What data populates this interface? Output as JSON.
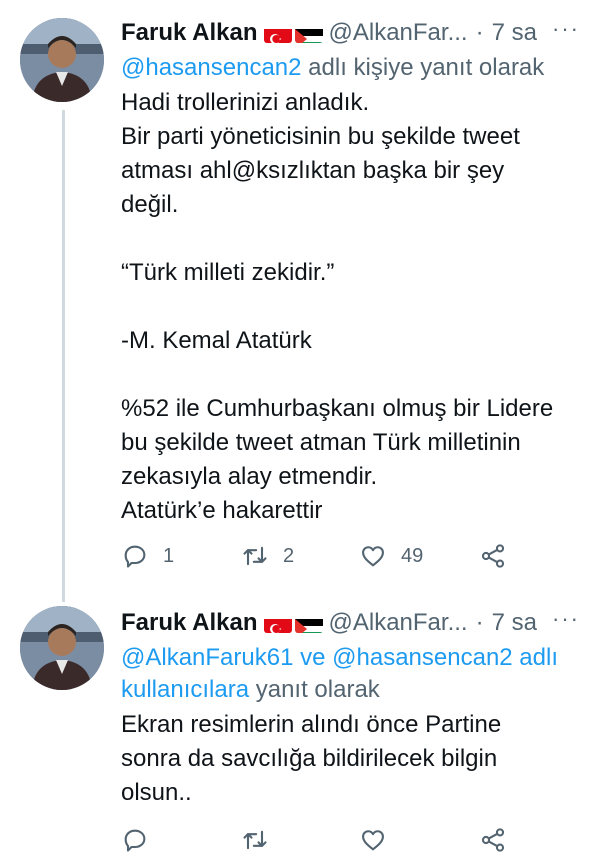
{
  "tweets": [
    {
      "name": "Faruk Alkan",
      "handle": "@AlkanFar...",
      "separator": "·",
      "time": "7 sa",
      "more": "···",
      "reply_to": {
        "mentions": [
          "@hasansencan2"
        ],
        "joiner": "",
        "suffix": " adlı kişiye yanıt olarak"
      },
      "body_lines": [
        "Hadi trollerinizi anladık.",
        "Bir parti yöneticisinin bu şekilde tweet",
        "atması ahl@ksızlıktan başka bir şey",
        "değil.",
        "",
        "“Türk milleti zekidir.”",
        "",
        "-M. Kemal Atatürk",
        "",
        "%52 ile Cumhurbaşkanı olmuş bir Lidere",
        "bu şekilde tweet atman Türk milletinin",
        "zekasıyla alay etmendir.",
        "Atatürk’e hakarettir"
      ],
      "actions": {
        "reply_count": "1",
        "retweet_count": "2",
        "like_count": "49"
      }
    },
    {
      "name": "Faruk Alkan",
      "handle": "@AlkanFar...",
      "separator": "·",
      "time": "7 sa",
      "more": "···",
      "reply_to": {
        "mention1": "@AlkanFaruk61",
        "joiner": " ve ",
        "mention2": "@hasansencan2 adlı",
        "line2_link": "kullanıcılara",
        "suffix": " yanıt olarak"
      },
      "body_lines": [
        "Ekran resimlerin alındı önce Partine",
        "sonra da savcılığa bildirilecek bilgin",
        "olsun.."
      ],
      "actions": {
        "reply_count": "",
        "retweet_count": "",
        "like_count": ""
      }
    }
  ],
  "colors": {
    "link": "#1d9bf0",
    "muted": "#536471",
    "text": "#0f1419",
    "thread_line": "#cfd9de"
  },
  "icons": [
    "reply-icon",
    "retweet-icon",
    "like-icon",
    "share-icon",
    "turkey-flag-icon",
    "palestine-flag-icon",
    "more-icon"
  ]
}
